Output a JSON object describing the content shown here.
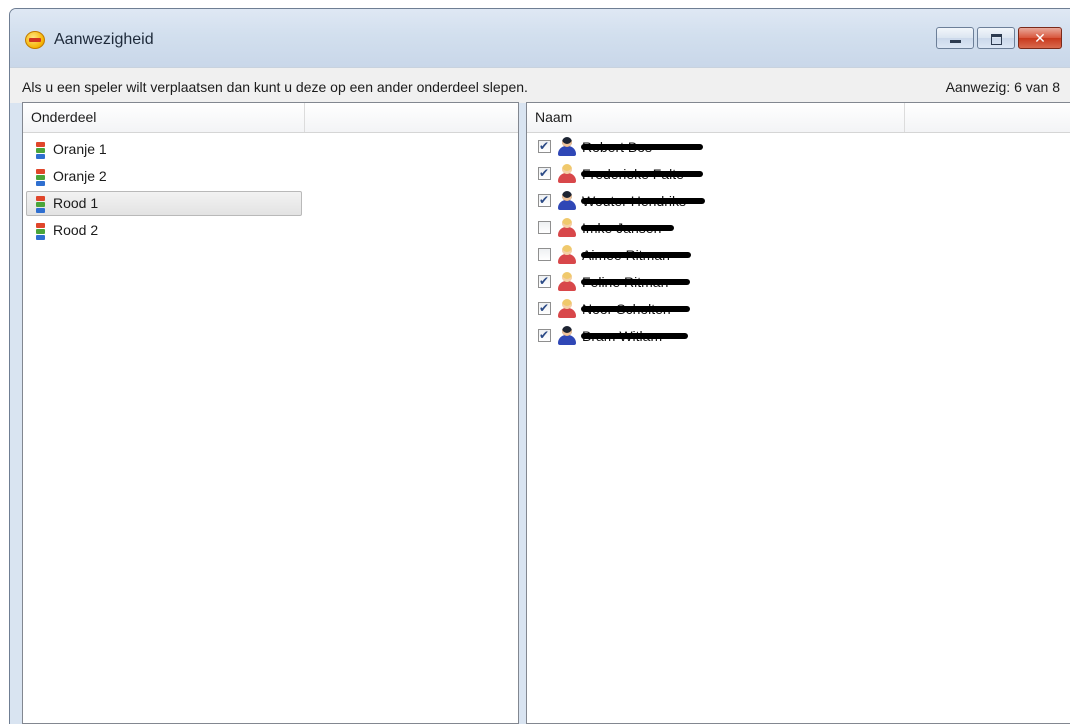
{
  "window": {
    "title": "Aanwezigheid",
    "controls": {
      "minimize": "",
      "maximize": "",
      "close": "✕"
    }
  },
  "infobar": {
    "hint": "Als u een speler wilt verplaatsen dan kunt u deze op een ander onderdeel slepen.",
    "count": "Aanwezig: 6 van 8"
  },
  "left_panel": {
    "column": "Onderdeel",
    "items": [
      {
        "label": "Oranje 1",
        "selected": false
      },
      {
        "label": "Oranje 2",
        "selected": false
      },
      {
        "label": "Rood 1",
        "selected": true
      },
      {
        "label": "Rood 2",
        "selected": false
      }
    ]
  },
  "right_panel": {
    "column": "Naam",
    "players": [
      {
        "name": "Robert Bos",
        "checked": true,
        "gender": "male-person-icon"
      },
      {
        "name": "Frederieke Falte",
        "checked": true,
        "gender": "female-person-icon"
      },
      {
        "name": "Wouter Hendriks",
        "checked": true,
        "gender": "male-person-icon"
      },
      {
        "name": "Imke Jansen",
        "checked": false,
        "gender": "female-person-icon"
      },
      {
        "name": "Aimee Ritman",
        "checked": false,
        "gender": "female-person-icon"
      },
      {
        "name": "Feline Ritman",
        "checked": true,
        "gender": "female-person-icon"
      },
      {
        "name": "Noor Scholten",
        "checked": true,
        "gender": "female-person-icon"
      },
      {
        "name": "Bram Witlam",
        "checked": true,
        "gender": "male-person-icon"
      }
    ]
  },
  "colors": {
    "titlebar": "#d2dfee",
    "close_button": "#c8381c",
    "selection": "#e3e3e3"
  }
}
